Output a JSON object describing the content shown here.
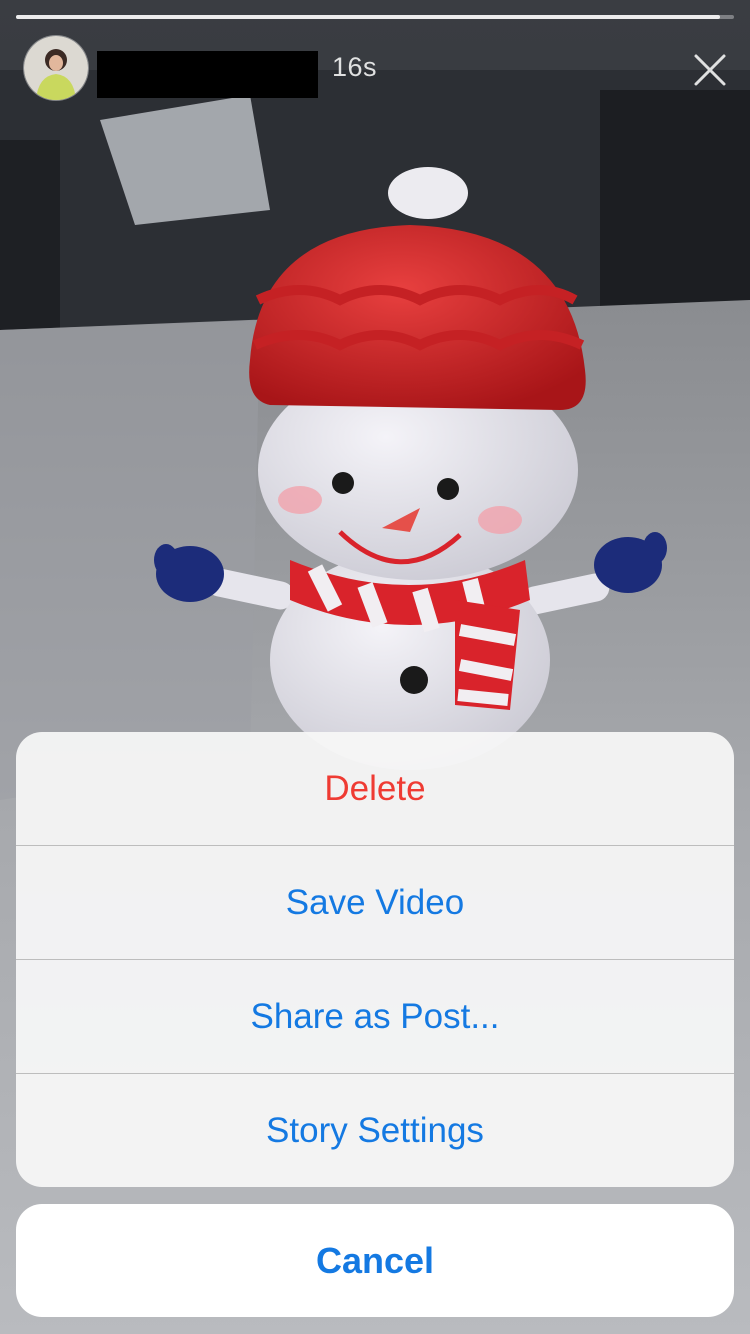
{
  "story": {
    "progress": 0.98,
    "time_ago": "16s"
  },
  "icons": {
    "close": "close-icon",
    "avatar": "profile-avatar"
  },
  "action_sheet": {
    "items": [
      {
        "label": "Delete",
        "style": "destructive"
      },
      {
        "label": "Save Video",
        "style": "default"
      },
      {
        "label": "Share as Post...",
        "style": "default"
      },
      {
        "label": "Story Settings",
        "style": "default"
      }
    ],
    "cancel_label": "Cancel"
  },
  "colors": {
    "accent": "#1479e2",
    "destructive": "#ef3b33",
    "sheet_background": "#f6f6f6"
  }
}
